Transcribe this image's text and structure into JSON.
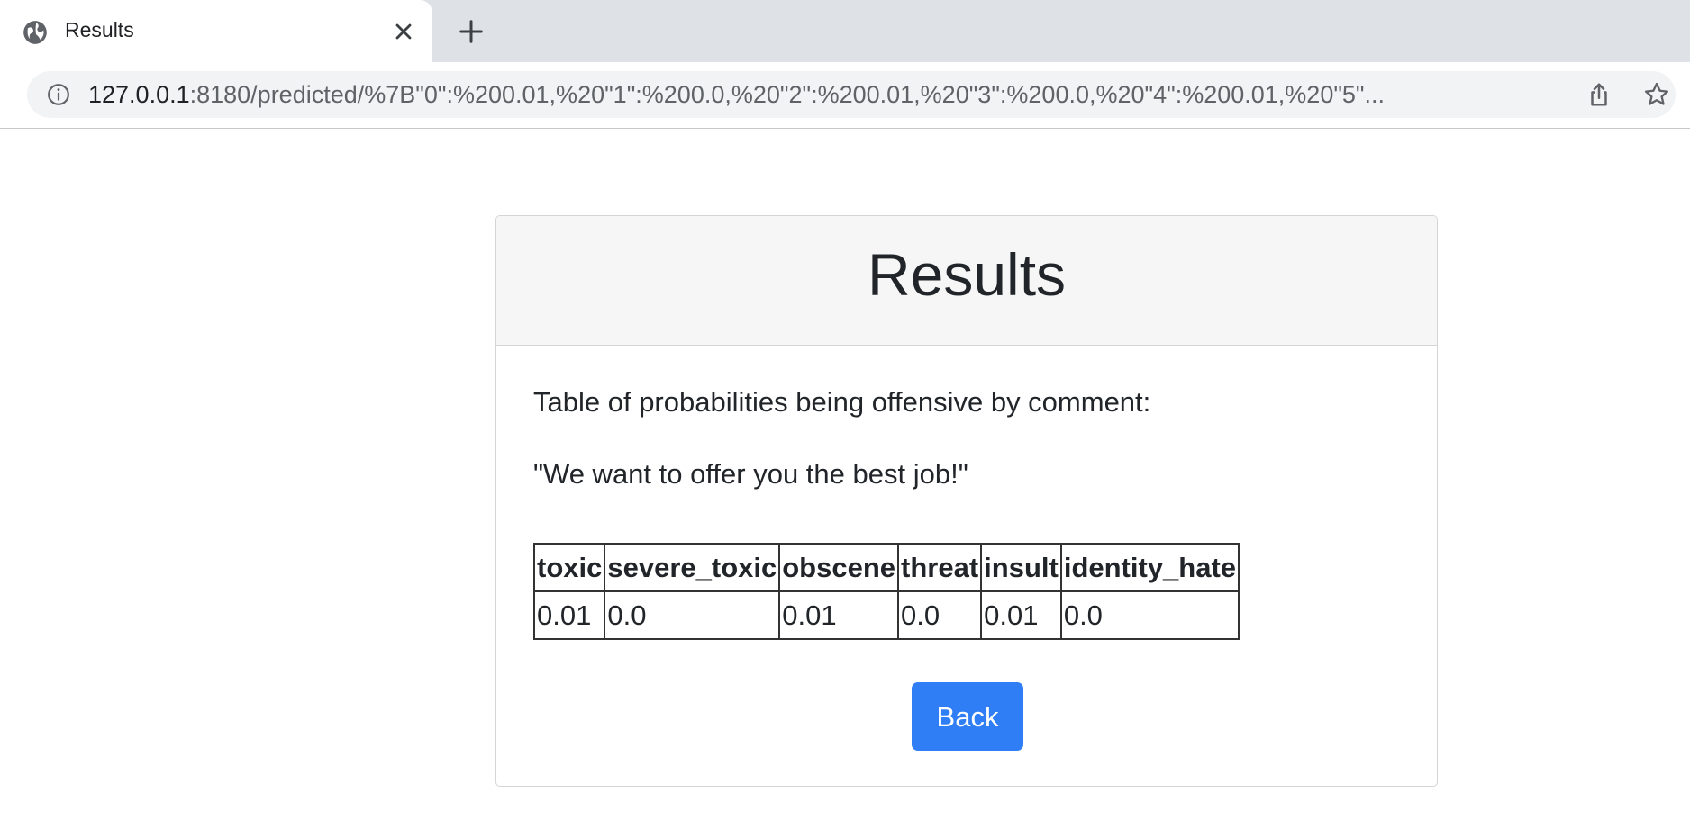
{
  "browser": {
    "tab": {
      "title": "Results",
      "favicon": "globe-icon",
      "close_icon": "close-icon"
    },
    "new_tab_icon": "plus-icon",
    "address_bar": {
      "host": "127.0.0.1",
      "rest": ":8180/predicted/%7B\"0\":%200.01,%20\"1\":%200.0,%20\"2\":%200.01,%20\"3\":%200.0,%20\"4\":%200.01,%20\"5\"...",
      "info_icon": "info-icon",
      "share_icon": "share-icon",
      "bookmark_icon": "star-icon"
    }
  },
  "page": {
    "heading": "Results",
    "intro": "Table of probabilities being offensive by comment:",
    "comment": "\"We want to offer you the best job!\"",
    "table": {
      "headers": [
        "toxic",
        "severe_toxic",
        "obscene",
        "threat",
        "insult",
        "identity_hate"
      ],
      "rows": [
        [
          "0.01",
          "0.0",
          "0.01",
          "0.0",
          "0.01",
          "0.0"
        ]
      ]
    },
    "back_button": "Back",
    "colors": {
      "button": "#2f7ef5",
      "header_bg": "#f6f6f6"
    }
  }
}
